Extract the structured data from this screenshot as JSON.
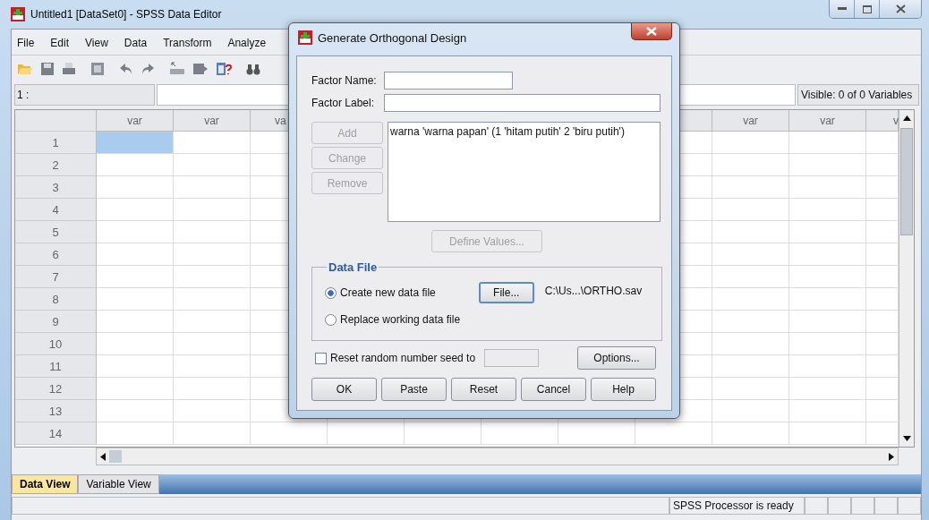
{
  "window": {
    "title": "Untitled1 [DataSet0] - SPSS Data Editor"
  },
  "menu": [
    "File",
    "Edit",
    "View",
    "Data",
    "Transform",
    "Analyze"
  ],
  "cell_ref": "1 :",
  "visible_info": "Visible: 0 of 0 Variables",
  "grid": {
    "columns_left": [
      "var",
      "var",
      "va"
    ],
    "columns_right": [
      "var",
      "var",
      "v"
    ],
    "rows": [
      {
        "label": "1",
        "selected": true
      },
      {
        "label": "2",
        "selected": false
      },
      {
        "label": "3",
        "selected": false
      },
      {
        "label": "4",
        "selected": false
      },
      {
        "label": "5",
        "selected": false
      },
      {
        "label": "6",
        "selected": false
      },
      {
        "label": "7",
        "selected": false
      },
      {
        "label": "8",
        "selected": false
      },
      {
        "label": "9",
        "selected": false
      },
      {
        "label": "10",
        "selected": false
      },
      {
        "label": "11",
        "selected": false
      },
      {
        "label": "12",
        "selected": false
      },
      {
        "label": "13",
        "selected": false
      },
      {
        "label": "14",
        "selected": false
      }
    ]
  },
  "view_tabs": [
    {
      "label": "Data View",
      "selected": true
    },
    {
      "label": "Variable View",
      "selected": false
    }
  ],
  "status": "SPSS  Processor is ready",
  "dialog": {
    "title": "Generate Orthogonal Design",
    "factor_name_label": "Factor Name:",
    "factor_label_label": "Factor Label:",
    "side_buttons": [
      {
        "label": "Add",
        "disabled": true
      },
      {
        "label": "Change",
        "disabled": true
      },
      {
        "label": "Remove",
        "disabled": true
      }
    ],
    "factors": [
      "warna 'warna papan' (1 'hitam putih' 2 'biru putih')"
    ],
    "define_values": {
      "label": "Define Values...",
      "disabled": true
    },
    "data_file": {
      "legend": "Data File",
      "options": [
        {
          "label": "Create new data file",
          "selected": true
        },
        {
          "label": "Replace working data file",
          "selected": false
        }
      ],
      "file_button": "File...",
      "path": "C:\\Us...\\ORTHO.sav"
    },
    "reset_seed": {
      "label": "Reset random number seed to",
      "checked": false
    },
    "options_button": "Options...",
    "buttons": [
      "OK",
      "Paste",
      "Reset",
      "Cancel",
      "Help"
    ]
  }
}
